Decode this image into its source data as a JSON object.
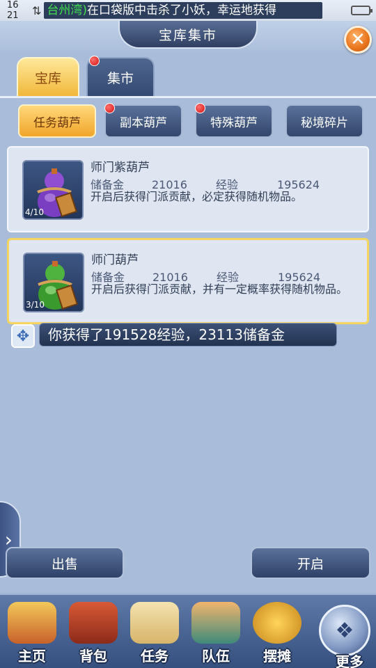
{
  "status_bar": {
    "time": "16 21",
    "ticker_highlight": "台州湾)",
    "ticker_text": "在口袋版中击杀了小妖，幸运地获得"
  },
  "header": {
    "title": "宝库集市",
    "close_symbol": "✕"
  },
  "tabs": [
    {
      "label": "宝库",
      "active": true
    },
    {
      "label": "集市",
      "active": false,
      "badge": true
    }
  ],
  "categories": [
    {
      "label": "任务葫芦",
      "active": true,
      "badge": false
    },
    {
      "label": "副本葫芦",
      "active": false,
      "badge": true
    },
    {
      "label": "特殊葫芦",
      "active": false,
      "badge": true
    },
    {
      "label": "秘境碎片",
      "active": false,
      "badge": false
    }
  ],
  "items": [
    {
      "name": "师门紫葫芦",
      "count": "4/10",
      "reserve_label": "储备金",
      "reserve_value": "21016",
      "exp_label": "经验",
      "exp_value": "195624",
      "description": "开启后获得门派贡献，必定获得随机物品。",
      "color": "#9b4fd3",
      "selected": false
    },
    {
      "name": "师门葫芦",
      "count": "3/10",
      "reserve_label": "储备金",
      "reserve_value": "21016",
      "exp_label": "经验",
      "exp_value": "195624",
      "description": "开启后获得门派贡献，并有一定概率获得随机物品。",
      "color": "#3fa33a",
      "selected": true
    }
  ],
  "toast": {
    "message": "你获得了191528经验，23113储备金"
  },
  "actions": {
    "sell_label": "出售",
    "open_label": "开启"
  },
  "nav": [
    {
      "label": "主页",
      "icon": "home-pavilion-icon"
    },
    {
      "label": "背包",
      "icon": "treasure-chest-icon"
    },
    {
      "label": "任务",
      "icon": "scroll-icon"
    },
    {
      "label": "队伍",
      "icon": "team-characters-icon"
    },
    {
      "label": "摆摊",
      "icon": "coin-stall-icon"
    },
    {
      "label": "更多",
      "icon": "more-icon"
    }
  ]
}
